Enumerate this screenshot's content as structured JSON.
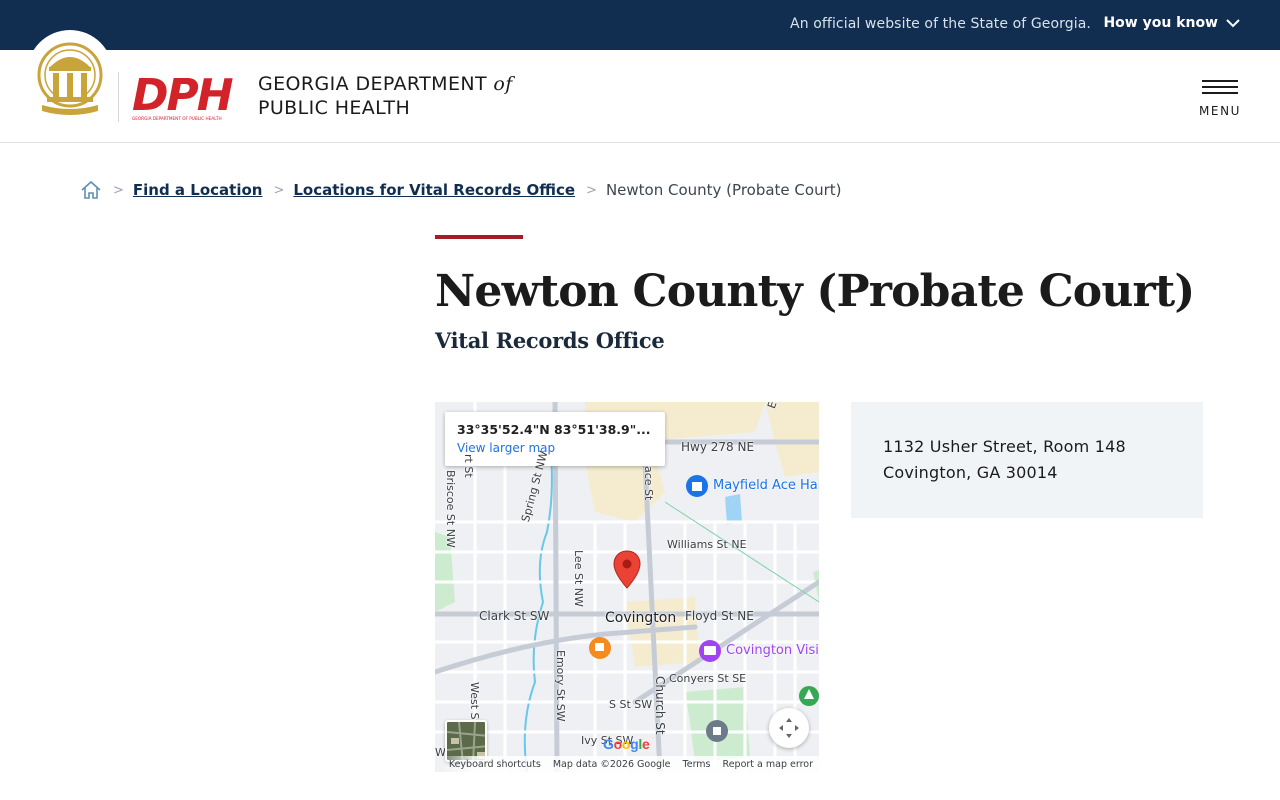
{
  "official_banner": {
    "text": "An official website of the State of Georgia.",
    "how_you_know": "How you know"
  },
  "header": {
    "agency_line1": "GEORGIA DEPARTMENT",
    "agency_of": "of",
    "agency_line2": "PUBLIC HEALTH",
    "logo_text": "DPH",
    "logo_caption": "GEORGIA DEPARTMENT OF PUBLIC HEALTH",
    "menu_label": "MENU"
  },
  "breadcrumb": {
    "items": [
      {
        "label": "Find a Location"
      },
      {
        "label": "Locations for Vital Records Office"
      }
    ],
    "current": "Newton County (Probate Court)"
  },
  "page": {
    "title": "Newton County (Probate Court)",
    "subtitle": "Vital Records Office"
  },
  "map": {
    "coords": "33°35'52.4\"N 83°51'38.9\"...",
    "view_larger": "View larger map",
    "labels": {
      "hwy": "Hwy 278 NE",
      "elm": "Elm S",
      "mayfield": "Mayfield Ace Har",
      "williams": "Williams St NE",
      "clark": "Clark St SW",
      "covington": "Covington",
      "floyd": "Floyd St NE",
      "covington_visit": "Covington Visit",
      "conyers": "Conyers St SE",
      "s_st": "S St SW",
      "ivy": "Ivy St SW",
      "lee": "Lee St NW",
      "spring": "Spring St NW",
      "briscoe": "Briscoe St NW",
      "pace": "ace St",
      "emory": "Emory St SW",
      "church": "Church St",
      "west": "West St",
      "st_top": "rt St",
      "w": "W"
    },
    "footer": {
      "shortcuts": "Keyboard shortcuts",
      "data": "Map data ©2026 Google",
      "terms": "Terms",
      "report": "Report a map error"
    },
    "google": "Google"
  },
  "address": {
    "line1": "1132 Usher Street, Room 148",
    "line2": "Covington, GA 30014"
  },
  "colors": {
    "banner_bg": "#112e51",
    "accent_red": "#a31c27",
    "card_bg": "#f1f4f7",
    "link": "#112e51"
  }
}
